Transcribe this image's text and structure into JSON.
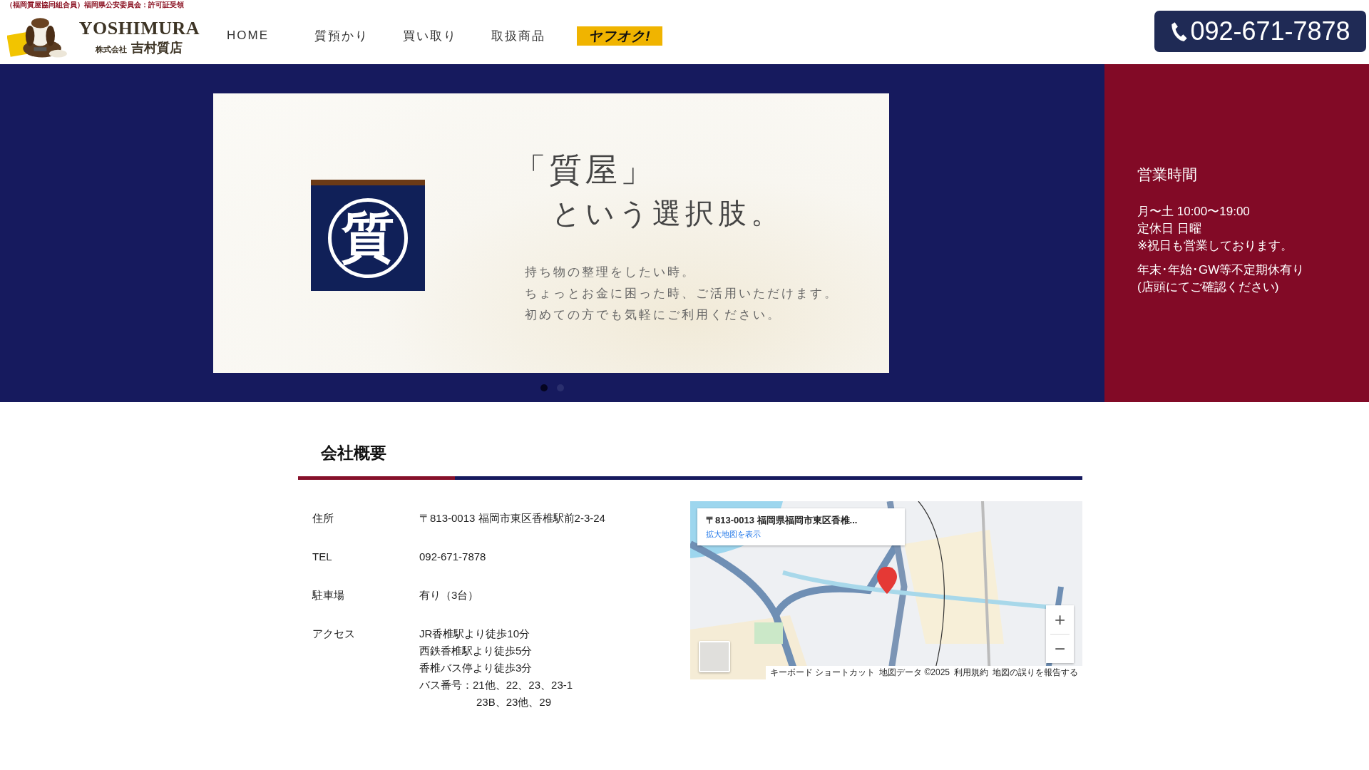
{
  "top_notice": "（福岡質屋協同組合員）福岡県公安委員会：許可証受領",
  "logo": {
    "name": "YOSHIMURA",
    "company_type": "株式会社",
    "company_name": "吉村質店"
  },
  "nav": [
    {
      "label": "HOME",
      "kind": "text"
    },
    {
      "label": "質預かり",
      "kind": "text"
    },
    {
      "label": "買い取り",
      "kind": "text"
    },
    {
      "label": "取扱商品",
      "kind": "text"
    },
    {
      "label": "ヤフオク!",
      "kind": "badge"
    }
  ],
  "phone": "092-671-7878",
  "slider": {
    "heading_1": "「質屋」",
    "heading_2": "という選択肢。",
    "noren_char": "質",
    "lines": [
      "持ち物の整理をしたい時。",
      "ちょっとお金に困った時、ご活用いただけます。",
      "初めての方でも気軽にご利用ください。"
    ],
    "dots": [
      {
        "selected": true
      },
      {
        "selected": false
      }
    ]
  },
  "hours": {
    "title": "営業時間",
    "lines": [
      "月〜土 10:00〜19:00",
      "定休日 日曜",
      "※祝日も営業しております。"
    ],
    "note_lines": [
      "年末･年始･GW等不定期休有り",
      "(店頭にてご確認ください)"
    ]
  },
  "company": {
    "title": "会社概要",
    "rows": [
      {
        "label": "住所",
        "values": [
          {
            "text": "〒813-0013 福岡市東区香椎駅前2-3-24",
            "kind": "line"
          }
        ]
      },
      {
        "label": "TEL",
        "values": [
          {
            "text": "092-671-7878",
            "kind": "line"
          }
        ]
      },
      {
        "label": "駐車場",
        "values": [
          {
            "text": "有り（3台）",
            "kind": "line"
          }
        ]
      },
      {
        "label": "アクセス",
        "values": [
          {
            "text": "JR香椎駅より徒歩10分",
            "kind": "line"
          },
          {
            "text": "西鉄香椎駅より徒歩5分",
            "kind": "line"
          },
          {
            "text": "香椎バス停より徒歩3分",
            "kind": "line"
          },
          {
            "text": "バス番号：21他、22、23、23-1",
            "kind": "line"
          },
          {
            "text": "23B、23他、29",
            "kind": "continuation"
          }
        ]
      }
    ]
  },
  "map": {
    "card_title": "〒813-0013 福岡県福岡市東区香椎...",
    "card_link": "拡大地図を表示",
    "zoom_in": "+",
    "zoom_out": "−",
    "footer": [
      "キーボード ショートカット",
      "地図データ ©2025",
      "利用規約",
      "地図の誤りを報告する"
    ]
  }
}
